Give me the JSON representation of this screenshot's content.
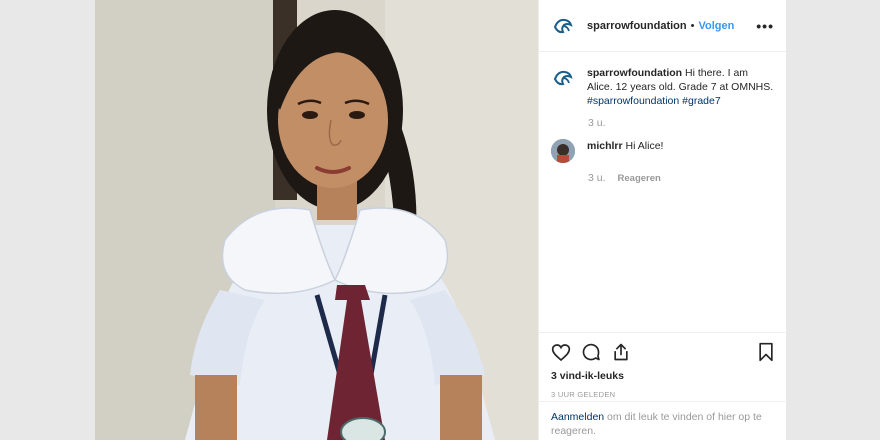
{
  "post": {
    "username": "sparrowfoundation",
    "dot": "•",
    "follow_label": "Volgen",
    "more_icon": "more-options-icon"
  },
  "caption": {
    "username": "sparrowfoundation",
    "text": " Hi there. I am Alice. 12 years old. Grade 7 at OMNHS.",
    "hashtag1": "#sparrowfoundation",
    "hashtag2": "#grade7",
    "time": "3 u."
  },
  "comment": {
    "username": "michlrr",
    "text": " Hi Alice!",
    "time": "3 u.",
    "reply_label": "Reageren"
  },
  "actions": {
    "likes": "3 vind-ik-leuks",
    "posted": "3 UUR GELEDEN"
  },
  "login": {
    "link": "Aanmelden",
    "text": " om dit leuk te vinden of hier op te reageren."
  },
  "colors": {
    "link": "#3897f0",
    "hashtag": "#003569",
    "logo": "#1a5f8a"
  }
}
